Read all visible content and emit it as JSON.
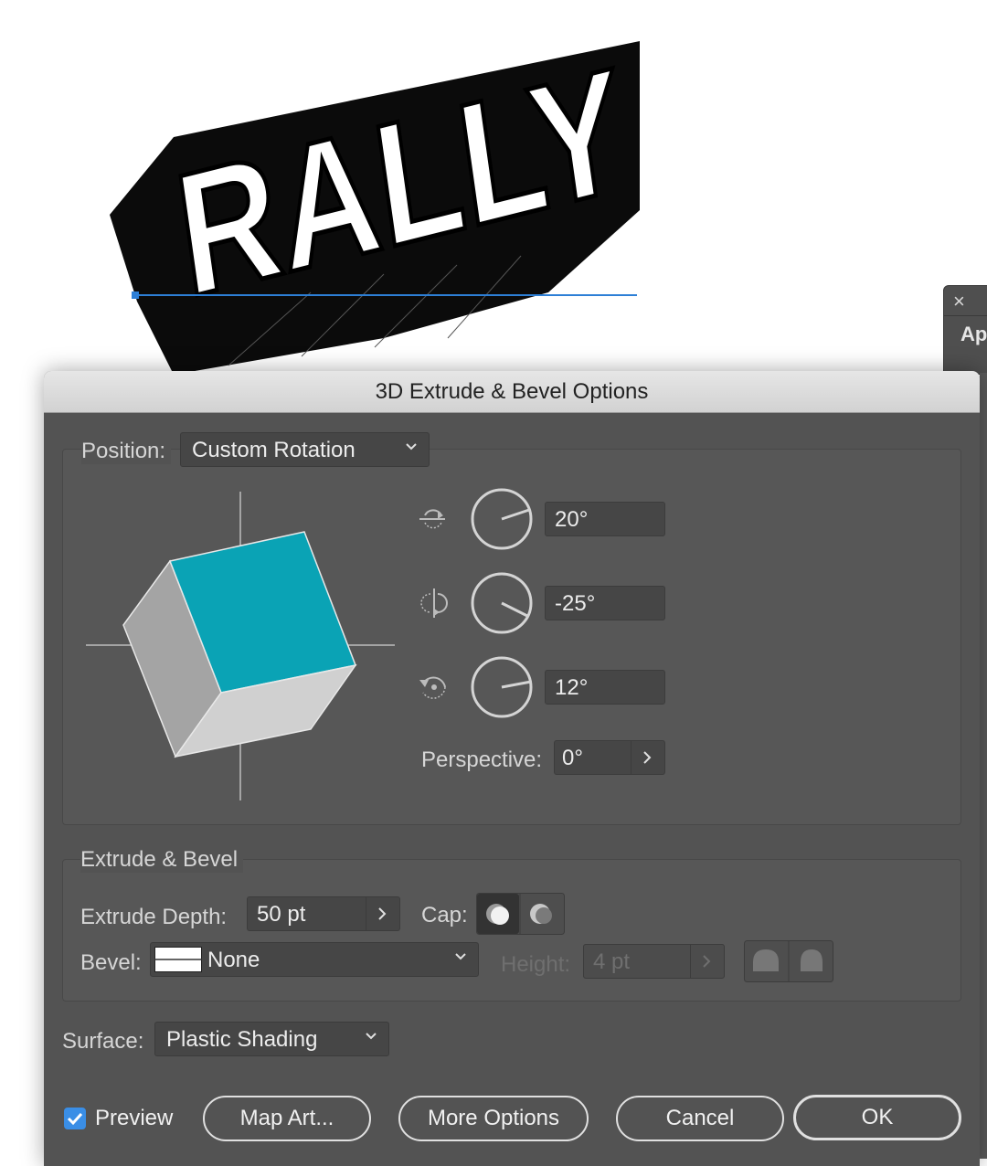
{
  "artwork": {
    "text": "RALLY"
  },
  "side_panel": {
    "close_glyph": "×",
    "title": "Ap"
  },
  "dialog": {
    "title": "3D Extrude & Bevel Options",
    "position": {
      "label": "Position:",
      "value": "Custom Rotation"
    },
    "rotation": {
      "x_value": "20°",
      "y_value": "-25°",
      "z_value": "12°",
      "perspective_label": "Perspective:",
      "perspective_value": "0°"
    },
    "extrude_bevel": {
      "section_label": "Extrude & Bevel",
      "depth_label": "Extrude Depth:",
      "depth_value": "50 pt",
      "cap_label": "Cap:",
      "bevel_label": "Bevel:",
      "bevel_value": "None",
      "height_label": "Height:",
      "height_value": "4 pt"
    },
    "surface": {
      "label": "Surface:",
      "value": "Plastic Shading"
    },
    "footer": {
      "preview_label": "Preview",
      "preview_checked": true,
      "map_art_label": "Map Art...",
      "more_options_label": "More Options",
      "cancel_label": "Cancel",
      "ok_label": "OK"
    },
    "colors": {
      "cube_front": "#0aa3b5",
      "cube_side": "#a4a4a4",
      "cube_bottom": "#d0d0d0",
      "accent": "#3a8ee6"
    }
  }
}
